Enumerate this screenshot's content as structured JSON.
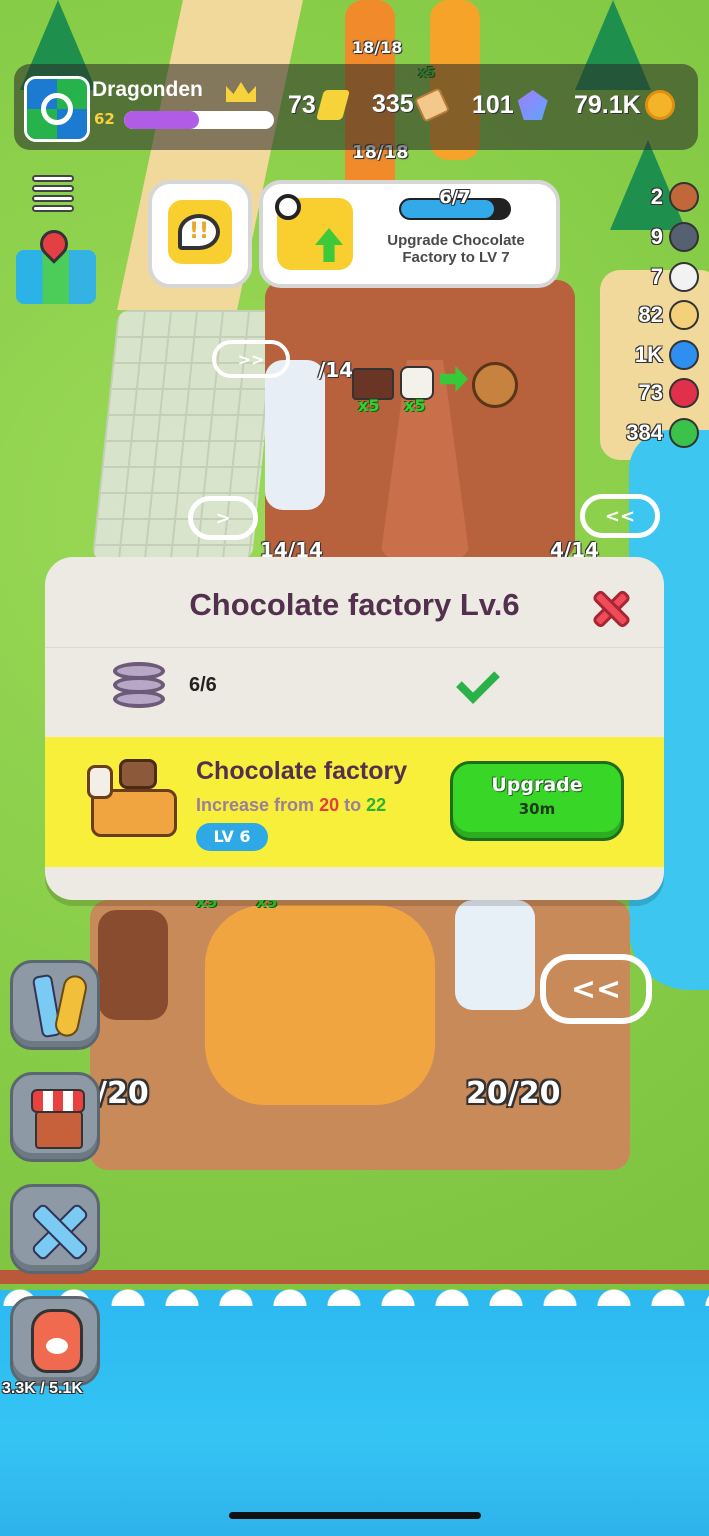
{
  "hud": {
    "player_name": "Dragonden",
    "player_level": "62",
    "xp_progress": 0.5,
    "resources": [
      {
        "value": "73",
        "icon": "ticket-icon"
      },
      {
        "value": "335",
        "icon": "scroll-icon"
      },
      {
        "value": "101",
        "icon": "gem-icon"
      },
      {
        "value": "79.1K",
        "icon": "coin-icon"
      }
    ]
  },
  "world_labels": {
    "top_counter_a": "18/18",
    "top_counter_b": "18/18",
    "top_x5": "x5",
    "milk_counter": "/14",
    "input_x5_a": "x5",
    "input_x5_b": "x5",
    "left_storage": "14/14",
    "right_storage": "4/14",
    "lower_left_storage": "/20",
    "lower_right_storage": "20/20",
    "lower_x5_a": "x5",
    "lower_x5_b": "x5"
  },
  "side_resources": [
    {
      "value": "2",
      "icon": "cocoa-bean-icon",
      "color": "#c2673a"
    },
    {
      "value": "9",
      "icon": "pot-icon",
      "color": "#556170"
    },
    {
      "value": "7",
      "icon": "cotton-icon",
      "color": "#f2f2f2"
    },
    {
      "value": "82",
      "icon": "egg-icon",
      "color": "#f4d07a"
    },
    {
      "value": "1K",
      "icon": "blue-crystal-icon",
      "color": "#2f8ff0"
    },
    {
      "value": "73",
      "icon": "ruby-icon",
      "color": "#e0304a"
    },
    {
      "value": "384",
      "icon": "emerald-icon",
      "color": "#3ac24a"
    }
  ],
  "quest": {
    "progress_text": "6/7",
    "progress_fraction": 0.857,
    "text": "Upgrade Chocolate Factory to LV 7"
  },
  "modal": {
    "title": "Chocolate factory Lv.6",
    "requirement_count": "6/6",
    "item_name": "Chocolate factory",
    "desc_prefix": "Increase from ",
    "from_value": "20",
    "desc_mid": " to ",
    "to_value": "22",
    "level_badge": "LV 6",
    "upgrade_label": "Upgrade",
    "upgrade_time": "30m"
  },
  "bag_capacity": "3.3K / 5.1K"
}
